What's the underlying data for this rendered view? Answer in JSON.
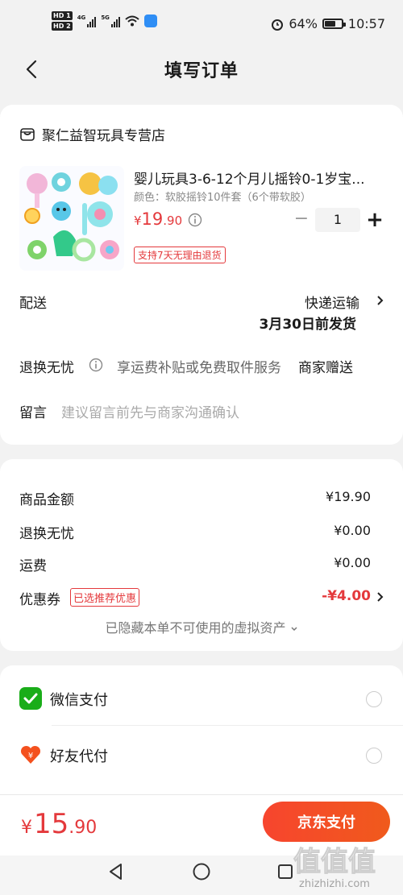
{
  "status_bar": {
    "hd1": "HD 1",
    "hd2": "HD 2",
    "net1": "4G",
    "net2": "5G",
    "battery": "64%",
    "time": "10:57"
  },
  "nav": {
    "title": "填写订单"
  },
  "store": {
    "name": "聚仁益智玩具专营店"
  },
  "product": {
    "title": "婴儿玩具3-6-12个月儿摇铃0-1岁宝...",
    "spec": "颜色：软胶摇铃10件套（6个带软胶）",
    "price_currency": "¥",
    "price_int": "19",
    "price_dec": ".90",
    "quantity": "1",
    "return_badge": "支持7天无理由退货"
  },
  "delivery": {
    "label": "配送",
    "method": "快递运输",
    "date": "3月30日前发货"
  },
  "service": {
    "label": "退换无忧",
    "desc": "享运费补贴或免费取件服务",
    "gift": "商家赠送"
  },
  "remark": {
    "label": "留言",
    "placeholder": "建议留言前先与商家沟通确认"
  },
  "summary": {
    "goods_label": "商品金额",
    "goods_value": "¥19.90",
    "service_label": "退换无忧",
    "service_value": "¥0.00",
    "freight_label": "运费",
    "freight_value": "¥0.00",
    "coupon_label": "优惠券",
    "coupon_badge": "已选推荐优惠",
    "coupon_value": "-¥4.00",
    "hidden_assets": "已隐藏本单不可使用的虚拟资产"
  },
  "payment": {
    "methods": [
      {
        "label": "微信支付",
        "icon": "wechat-pay-icon"
      },
      {
        "label": "好友代付",
        "icon": "friend-pay-icon"
      }
    ]
  },
  "bottom": {
    "currency": "¥",
    "total_int": "15",
    "total_dec": ".90",
    "pay_button": "京东支付"
  },
  "watermark": {
    "text": "值 值 值",
    "sub": "zhizhizhi.com"
  },
  "colors": {
    "accent": "#e4393c",
    "button": "#f7452e",
    "wechat": "#1aad19"
  }
}
